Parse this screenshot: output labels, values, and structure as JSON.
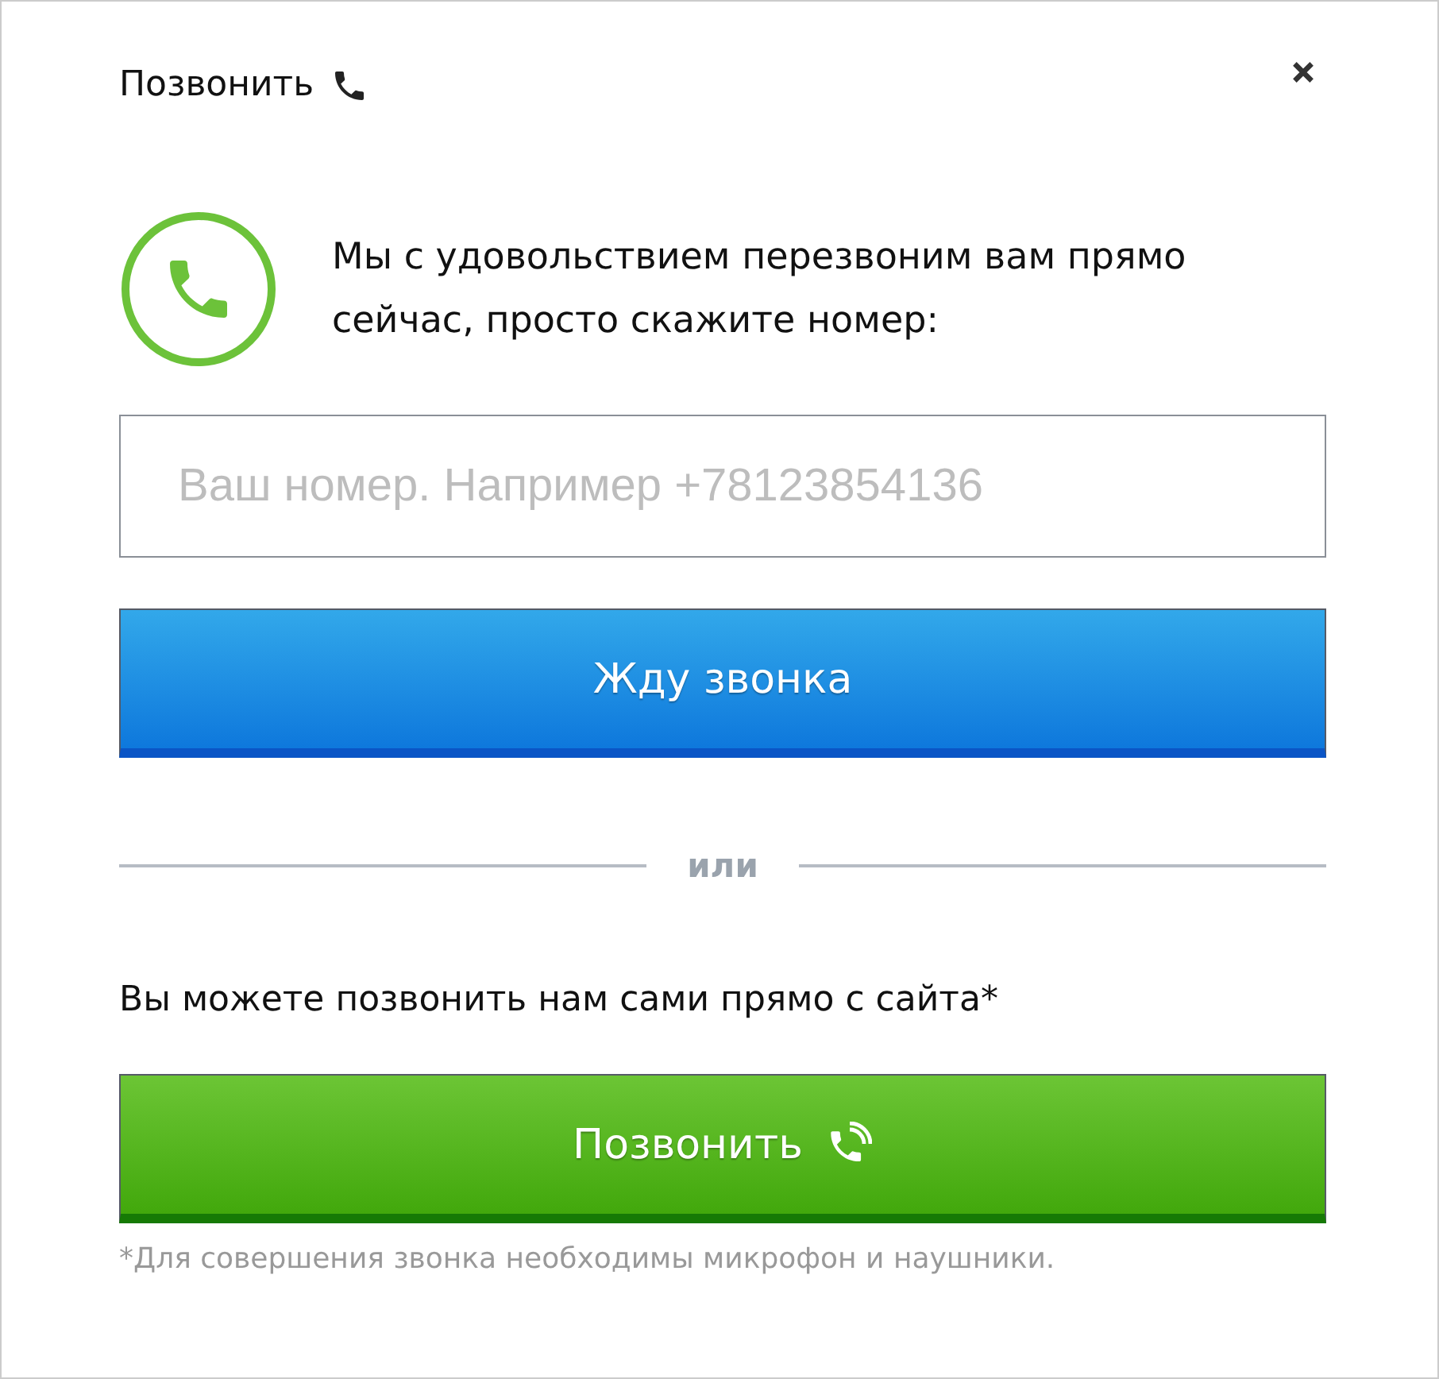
{
  "dialog": {
    "title": "Позвонить",
    "message": "Мы с удовольствием перезвоним вам прямо сейчас, просто скажите номер:"
  },
  "phone_field": {
    "placeholder": "Ваш номер. Например +78123854136"
  },
  "callback_button": {
    "label": "Жду звонка"
  },
  "separator": "или",
  "web_call_text": "Вы можете позвонить нам сами прямо с сайта*",
  "call_button": {
    "label": "Позвонить"
  },
  "footnote": "*Для совершения звонка необходимы микрофон и наушники."
}
